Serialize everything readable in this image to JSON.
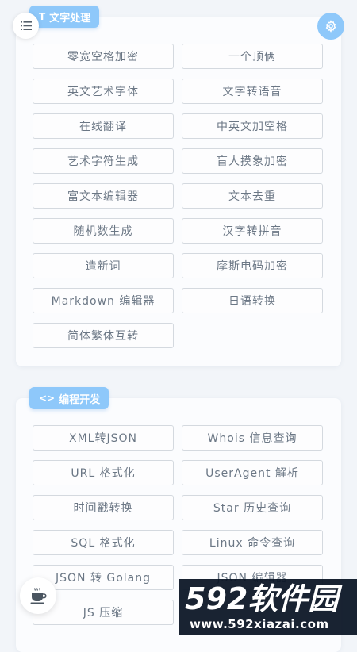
{
  "sections": [
    {
      "title": "文字处理",
      "icon": "T",
      "icon_name": "text-icon",
      "tools": [
        "零宽空格加密",
        "一个顶俩",
        "英文艺术字体",
        "文字转语音",
        "在线翻译",
        "中英文加空格",
        "艺术字符生成",
        "盲人摸象加密",
        "富文本编辑器",
        "文本去重",
        "随机数生成",
        "汉字转拼音",
        "造新词",
        "摩斯电码加密",
        "Markdown 编辑器",
        "日语转换",
        "简体繁体互转"
      ]
    },
    {
      "title": "编程开发",
      "icon": "<>",
      "icon_name": "code-icon",
      "tools": [
        "XML转JSON",
        "Whois 信息查询",
        "URL 格式化",
        "UserAgent 解析",
        "时间戳转换",
        "Star 历史查询",
        "SQL 格式化",
        "Linux 命令查询",
        "JSON 转 Golang",
        "JSON 编辑器",
        "JS 压缩"
      ]
    }
  ],
  "fabs": {
    "menu_icon": "menu-icon",
    "settings_icon": "gear-icon",
    "coffee_icon": "coffee-icon"
  },
  "watermark": {
    "logo": "592软件园",
    "url": "www.592xiazai.com"
  },
  "colors": {
    "accent": "#8ec8fa",
    "button_border": "#d4d9df",
    "button_text": "#6b7785",
    "background": "#f2f5f9",
    "card": "#fbfcfe"
  }
}
